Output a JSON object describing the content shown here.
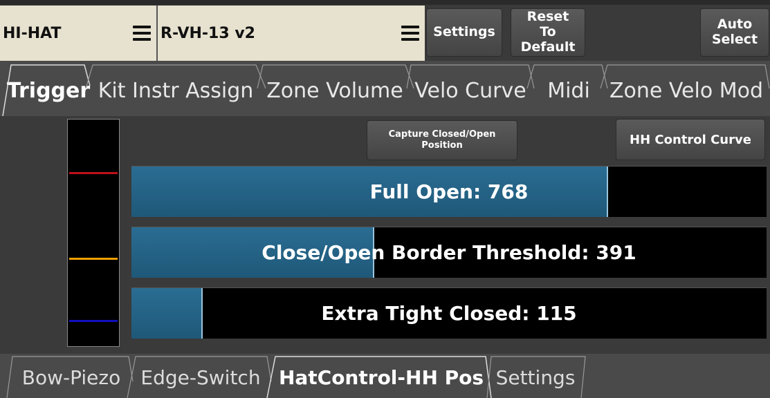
{
  "topbar": {
    "instrument_selector": {
      "label": "HI-HAT",
      "icon": "hamburger-menu-icon"
    },
    "model_selector": {
      "label": "R-VH-13 v2",
      "icon": "hamburger-menu-icon"
    },
    "settings_label": "Settings",
    "reset_label": "Reset\nTo Default",
    "auto_select_label": "Auto\nSelect"
  },
  "tabs": [
    {
      "label": "Trigger",
      "active": true
    },
    {
      "label": "Kit Instr Assign",
      "active": false
    },
    {
      "label": "Zone Volume",
      "active": false
    },
    {
      "label": "Velo Curve",
      "active": false
    },
    {
      "label": "Midi",
      "active": false
    },
    {
      "label": "Zone Velo Mod",
      "active": false
    }
  ],
  "main": {
    "capture_button_label": "Capture Closed/Open\nPosition",
    "hh_control_curve_label": "HH Control Curve",
    "meter_marker_colors": {
      "full_open": "#c0101a",
      "threshold": "#f0a000",
      "extra_tight": "#1010c0"
    },
    "bars": [
      {
        "label": "Full Open: 768",
        "value": 768,
        "max": 1023
      },
      {
        "label": "Close/Open Border Threshold: 391",
        "value": 391,
        "max": 1023
      },
      {
        "label": "Extra Tight Closed: 115",
        "value": 115,
        "max": 1023
      }
    ],
    "accent_color": "#2a6d93"
  },
  "bottom_tabs": [
    {
      "label": "Bow-Piezo",
      "active": false
    },
    {
      "label": "Edge-Switch",
      "active": false
    },
    {
      "label": "HatControl-HH Pos",
      "active": true
    },
    {
      "label": "Settings",
      "active": false
    }
  ]
}
